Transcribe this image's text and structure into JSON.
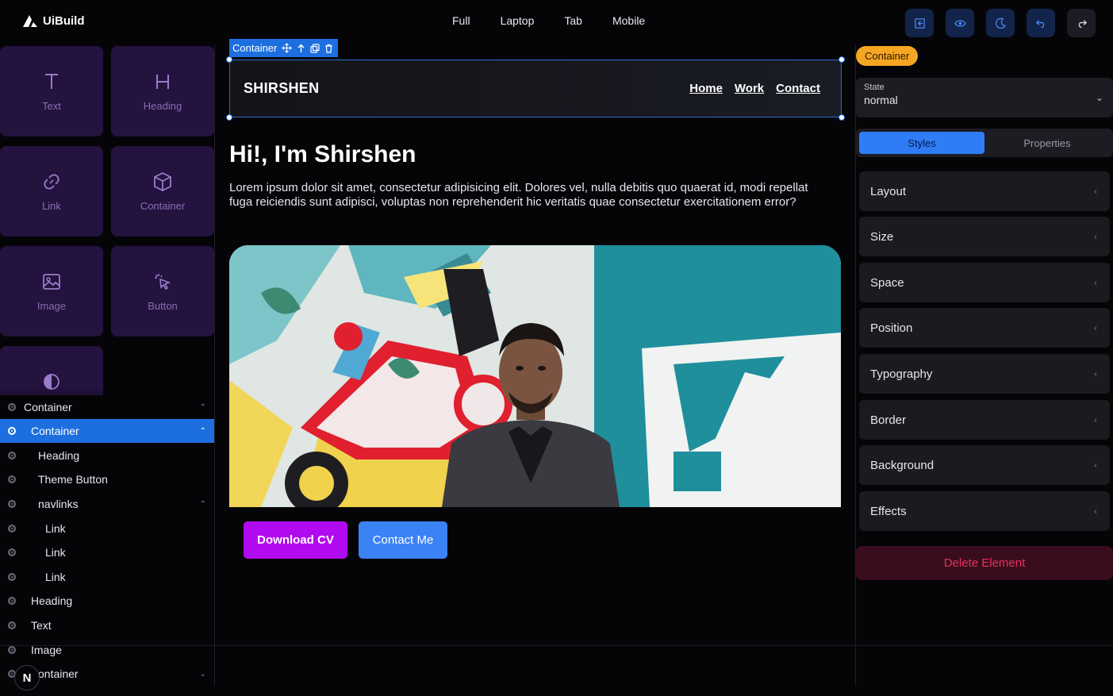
{
  "app": {
    "name": "UiBuild"
  },
  "devices": [
    "Full",
    "Laptop",
    "Tab",
    "Mobile"
  ],
  "toolbar": {
    "icons": [
      "import-icon",
      "preview-eye-icon",
      "moon-icon",
      "undo-icon",
      "redo-icon"
    ]
  },
  "palette": {
    "items": [
      {
        "label": "Text",
        "icon": "text-T-icon"
      },
      {
        "label": "Heading",
        "icon": "heading-H-icon"
      },
      {
        "label": "Link",
        "icon": "link-icon"
      },
      {
        "label": "Container",
        "icon": "box-icon"
      },
      {
        "label": "Image",
        "icon": "image-icon"
      },
      {
        "label": "Button",
        "icon": "pointer-click-icon"
      }
    ],
    "partial_icon": "theme-icon"
  },
  "layers": [
    {
      "label": "Container",
      "expanded": true,
      "active": false
    },
    {
      "label": "Container",
      "expanded": true,
      "active": true
    },
    {
      "label": "Heading",
      "active": false
    },
    {
      "label": "Theme Button",
      "active": false
    },
    {
      "label": "navlinks",
      "expanded": true,
      "active": false
    },
    {
      "label": "Link",
      "active": false
    },
    {
      "label": "Link",
      "active": false
    },
    {
      "label": "Link",
      "active": false
    },
    {
      "label": "Heading",
      "active": false
    },
    {
      "label": "Text",
      "active": false
    },
    {
      "label": "Image",
      "active": false
    },
    {
      "label": "ontainer",
      "expanded": false,
      "active": false
    }
  ],
  "badge": "N",
  "selection": {
    "label": "Container",
    "tools": [
      "move-icon",
      "arrow-up-icon",
      "duplicate-icon",
      "trash-icon"
    ]
  },
  "site": {
    "brand": "SHIRSHEN",
    "nav": [
      "Home",
      "Work",
      "Contact"
    ],
    "title": "Hi!, I'm Shirshen",
    "text": "Lorem ipsum dolor sit amet, consectetur adipisicing elit. Dolores vel, nulla debitis quo quaerat id, modi repellat fuga reiciendis sunt adipisci, voluptas non reprehenderit hic veritatis quae consectetur exercitationem error?",
    "download_label": "Download CV",
    "contact_label": "Contact Me"
  },
  "inspector": {
    "chip": "Container",
    "state_label": "State",
    "state_value": "normal",
    "tabs": [
      "Styles",
      "Properties"
    ],
    "sections": [
      "Layout",
      "Size",
      "Space",
      "Position",
      "Typography",
      "Border",
      "Background",
      "Effects"
    ],
    "delete_label": "Delete Element"
  },
  "colors": {
    "accent": "#1d6fe0",
    "primary_button": "#b10af0",
    "secondary_button": "#3b82f6",
    "chip": "#f5a623",
    "danger": "#e0345a"
  }
}
